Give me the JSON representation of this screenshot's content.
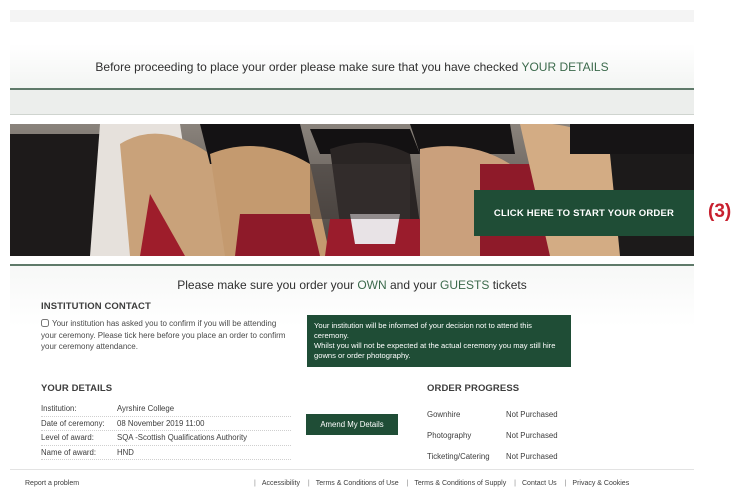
{
  "notice": {
    "text_before": "Before proceeding to place your order please make sure that you have checked ",
    "highlight": "YOUR DETAILS"
  },
  "banner": {
    "start_button": "CLICK HERE TO START YOUR ORDER",
    "step_label": "(3)"
  },
  "panel": {
    "title_part1": "Please make sure you order your ",
    "title_own": "OWN",
    "title_part2": " and your ",
    "title_guests": "GUESTS",
    "title_part3": " tickets"
  },
  "institution_contact": {
    "heading": "INSTITUTION CONTACT",
    "checkbox_text": "Your institution has asked you to confirm if you will be attending your ceremony. Please tick here before you place an order to confirm your ceremony attendance.",
    "info_text": "Your institution will be informed of your decision not to attend this ceremony.\nWhilst you will not be expected at the actual ceremony you may still hire gowns or order photography."
  },
  "your_details": {
    "heading": "YOUR DETAILS",
    "rows": [
      {
        "label": "Institution:",
        "value": "Ayrshire College"
      },
      {
        "label": "Date of ceremony:",
        "value": "08 November 2019 11:00"
      },
      {
        "label": "Level of award:",
        "value": "SQA -Scottish Qualifications Authority"
      },
      {
        "label": "Name of award:",
        "value": "HND"
      }
    ],
    "amend_button": "Amend My Details"
  },
  "order_progress": {
    "heading": "ORDER PROGRESS",
    "rows": [
      {
        "label": "Gownhire",
        "status": "Not Purchased"
      },
      {
        "label": "Photography",
        "status": "Not Purchased"
      },
      {
        "label": "Ticketing/Catering",
        "status": "Not Purchased"
      }
    ]
  },
  "footer": {
    "report": "Report a problem",
    "links": [
      "Accessibility",
      "Terms & Conditions of Use",
      "Terms & Conditions of Supply",
      "Contact Us",
      "Privacy & Cookies"
    ]
  },
  "colors": {
    "brand_green": "#1f4d36",
    "highlight_green": "#3c6a4c",
    "step_red": "#c8202f"
  }
}
